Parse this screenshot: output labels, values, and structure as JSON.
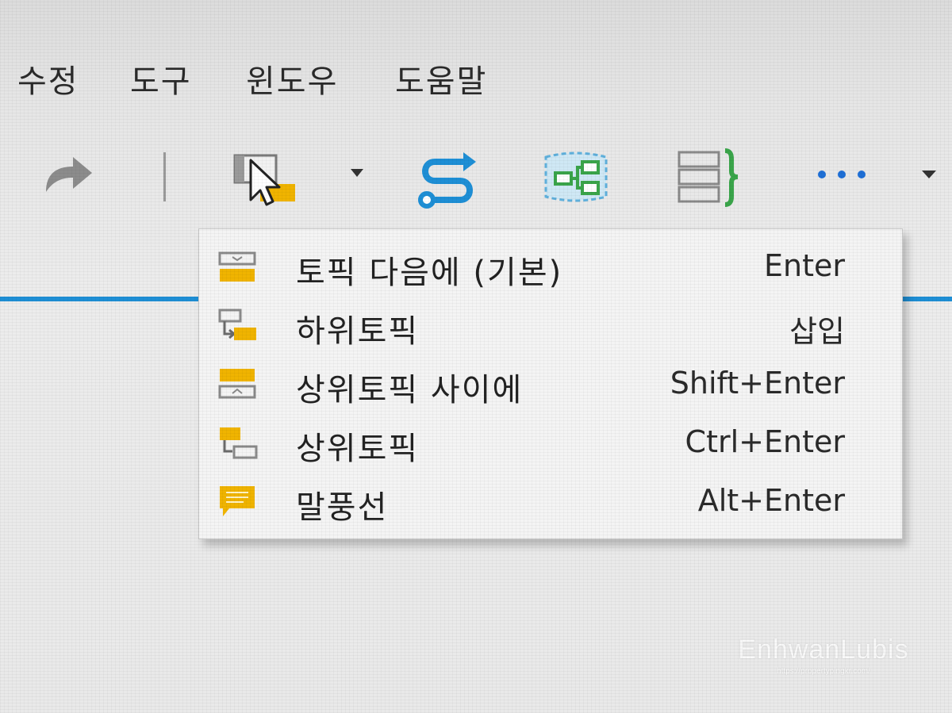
{
  "menubar": {
    "items": [
      "수정",
      "도구",
      "윈도우",
      "도움말"
    ]
  },
  "toolbar": {
    "icons": [
      "redo-icon",
      "insert-topic-icon",
      "relationship-icon",
      "boundary-icon",
      "summary-icon",
      "more-icon"
    ]
  },
  "dropdown": {
    "items": [
      {
        "label": "토픽 다음에 (기본)",
        "shortcut": "Enter",
        "icon": "topic-after-icon"
      },
      {
        "label": "하위토픽",
        "shortcut": "삽입",
        "icon": "subtopic-icon"
      },
      {
        "label": "상위토픽 사이에",
        "shortcut": "Shift+Enter",
        "icon": "topic-before-icon"
      },
      {
        "label": "상위토픽",
        "shortcut": "Ctrl+Enter",
        "icon": "parent-topic-icon"
      },
      {
        "label": "말풍선",
        "shortcut": "Alt+Enter",
        "icon": "callout-icon"
      }
    ]
  },
  "colors": {
    "accent_blue": "#1e8fd6",
    "topic_yellow": "#f0b400",
    "boundary_green": "#3aa54a"
  },
  "watermark": {
    "name": "EnhwanLubis",
    "url": "https://propertypingkr.com/"
  }
}
